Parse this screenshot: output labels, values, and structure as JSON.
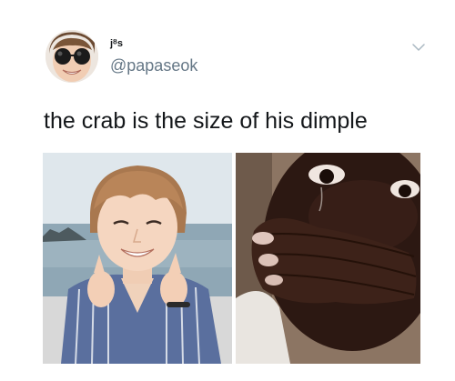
{
  "tweet": {
    "display_name": "jᴽs",
    "handle": "@papaseok",
    "text": "the crab is the size of his dimple"
  },
  "icons": {
    "avatar": "avatar-photo",
    "menu": "chevron-down-icon"
  },
  "media": [
    {
      "name": "photo-smiling-man-beach"
    },
    {
      "name": "photo-crying-covering-mouth"
    }
  ],
  "colors": {
    "text": "#14171a",
    "secondary_text": "#657786",
    "chevron": "#aab8c2"
  }
}
